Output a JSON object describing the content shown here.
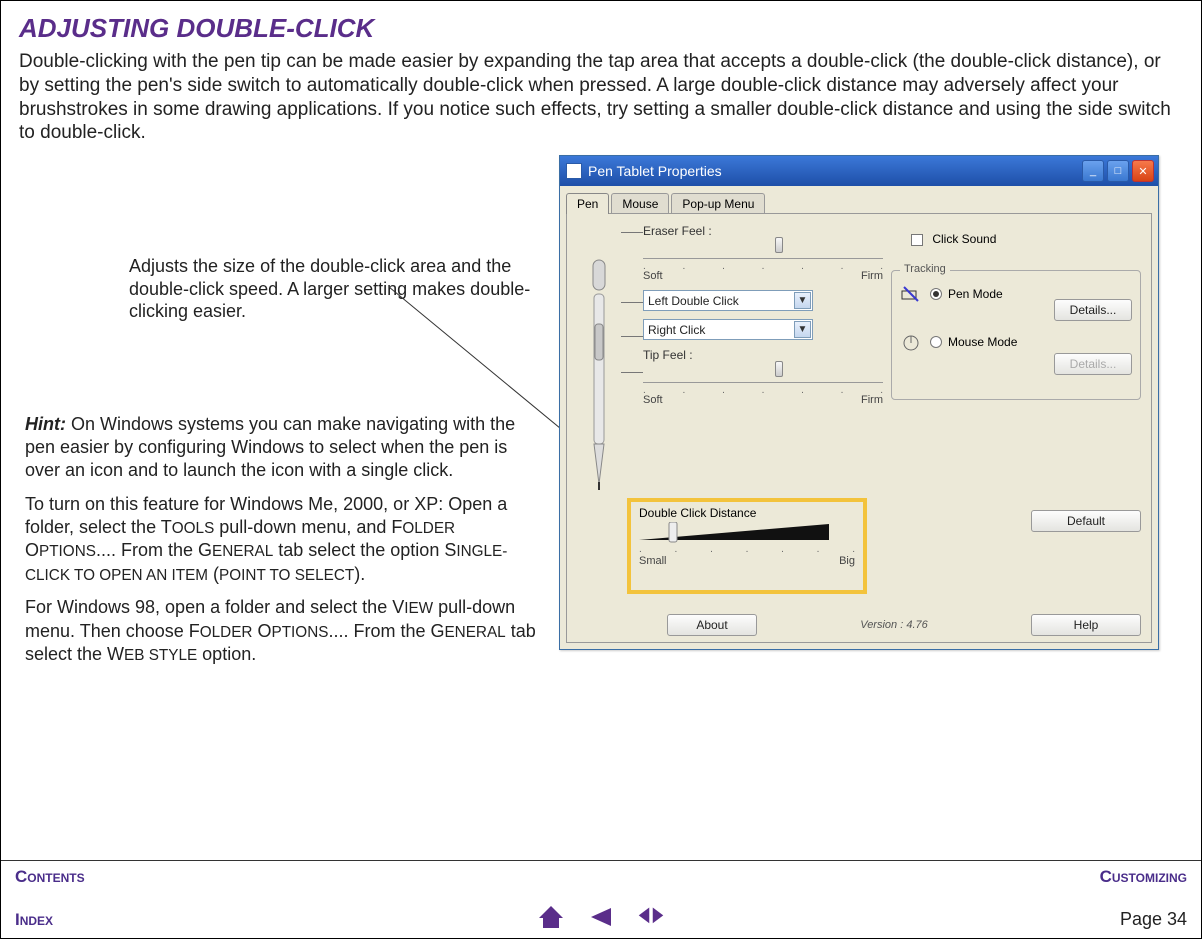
{
  "page": {
    "title": "ADJUSTING DOUBLE-CLICK",
    "body": "Double-clicking with the pen tip can be made easier by expanding the tap area that accepts a double-click (the double-click distance), or by setting the pen's side switch to automatically double-click when pressed.  A large double-click distance may adversely affect your brushstrokes in some drawing applications.  If you notice such effects, try setting a smaller double-click distance and using the side switch to double-click."
  },
  "callout": {
    "text": "Adjusts the size of the double-click area and the double-click speed.  A larger setting makes double-clicking easier."
  },
  "hint": {
    "label": "Hint:",
    "p1": " On Windows systems you can make navigating with the pen easier by configuring Windows to select when the pen is over an icon and to launch the icon with a single click.",
    "p2_a": "To turn on this feature for Windows Me, 2000, or XP: Open a folder, select the T",
    "p2_b": "OOLS",
    "p2_c": " pull-down menu, and F",
    "p2_d": "OLDER",
    "p2_e": " O",
    "p2_f": "PTIONS",
    "p2_g": "....  From the G",
    "p2_h": "ENERAL",
    "p2_i": " tab select the option S",
    "p2_j": "INGLE-CLICK TO OPEN AN ITEM",
    "p2_k": " (",
    "p2_l": "POINT TO SELECT",
    "p2_m": ").",
    "p3_a": "For Windows 98, open a folder and select the V",
    "p3_b": "IEW",
    "p3_c": " pull-down menu.  Then choose F",
    "p3_d": "OLDER",
    "p3_e": " O",
    "p3_f": "PTIONS",
    "p3_g": "....  From the G",
    "p3_h": "ENERAL",
    "p3_i": " tab select the W",
    "p3_j": "EB STYLE",
    "p3_k": " option."
  },
  "dialog": {
    "title": "Pen Tablet Properties",
    "tabs": {
      "pen": "Pen",
      "mouse": "Mouse",
      "popup": "Pop-up Menu"
    },
    "eraser_label": "Eraser Feel :",
    "soft": "Soft",
    "firm": "Firm",
    "combo1": "Left Double Click",
    "combo2": "Right Click",
    "tip_label": "Tip Feel :",
    "dcd_label": "Double Click Distance",
    "small": "Small",
    "big": "Big",
    "click_sound": "Click Sound",
    "tracking_legend": "Tracking",
    "pen_mode": "Pen Mode",
    "mouse_mode": "Mouse Mode",
    "details": "Details...",
    "default": "Default",
    "about": "About",
    "version": "Version : 4.76",
    "help": "Help"
  },
  "footer": {
    "contents": "Contents",
    "customizing": "Customizing",
    "index": "Index",
    "page": "Page  34"
  }
}
